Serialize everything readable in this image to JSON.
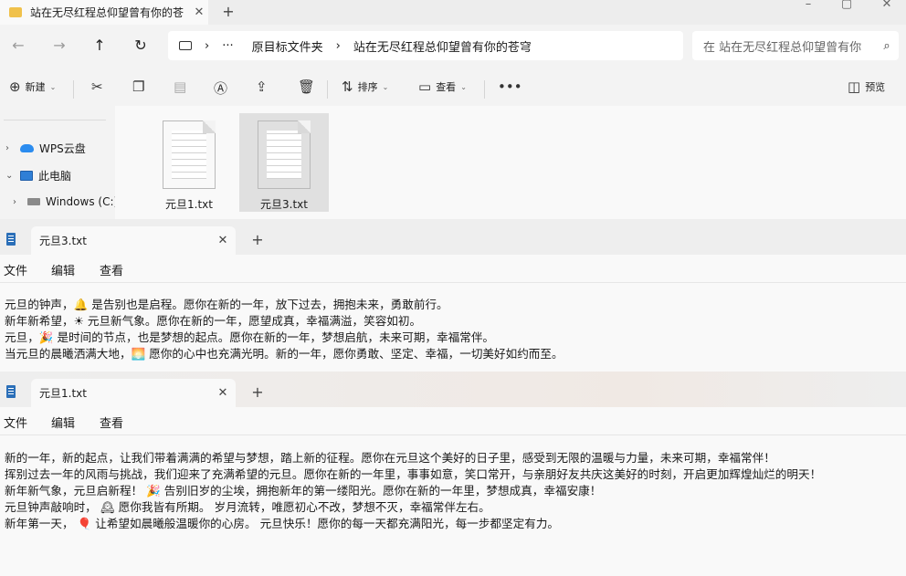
{
  "explorer": {
    "tab_title": "站在无尽红程总仰望曾有你的苍",
    "breadcrumb": [
      "原目标文件夹",
      "站在无尽红程总仰望曾有你的苍穹"
    ],
    "search_placeholder": "在 站在无尽红程总仰望曾有你",
    "toolbar": {
      "new_label": "新建",
      "sort_label": "排序",
      "view_label": "查看",
      "preview_label": "预览"
    },
    "nav_items": [
      {
        "label": "WPS云盘",
        "icon": "cloud-icon"
      },
      {
        "label": "此电脑",
        "icon": "computer-icon"
      },
      {
        "label": "Windows (C:)",
        "icon": "drive-icon"
      }
    ],
    "files": [
      {
        "name": "元旦1.txt",
        "selected": false
      },
      {
        "name": "元旦3.txt",
        "selected": true
      }
    ]
  },
  "notepad_top": {
    "tab_title": "元旦3.txt",
    "menu": [
      "文件",
      "编辑",
      "查看"
    ],
    "lines": [
      "元旦的钟声，🔔 是告别也是启程。愿你在新的一年，放下过去，拥抱未来，勇敢前行。",
      "新年新希望，☀ 元旦新气象。愿你在新的一年，愿望成真，幸福满溢，笑容如初。",
      "元旦，🎉 是时间的节点，也是梦想的起点。愿你在新的一年，梦想启航，未来可期，幸福常伴。",
      "当元旦的晨曦洒满大地，🌅 愿你的心中也充满光明。新的一年，愿你勇敢、坚定、幸福，一切美好如约而至。"
    ]
  },
  "notepad_bottom": {
    "tab_title": "元旦1.txt",
    "menu": [
      "文件",
      "编辑",
      "查看"
    ],
    "lines": [
      "新的一年，新的起点，让我们带着满满的希望与梦想，踏上新的征程。愿你在元旦这个美好的日子里，感受到无限的温暖与力量，未来可期，幸福常伴！",
      "挥别过去一年的风雨与挑战，我们迎来了充满希望的元旦。愿你在新的一年里，事事如意，笑口常开，与亲朋好友共庆这美好的时刻，开启更加辉煌灿烂的明天！",
      "新年新气象，元旦启新程！ 🎉 告别旧岁的尘埃，拥抱新年的第一缕阳光。愿你在新的一年里，梦想成真，幸福安康！",
      "元旦钟声敲响时， 🕰 愿你我皆有所期。 岁月流转，唯愿初心不改，梦想不灭，幸福常伴左右。",
      "新年第一天， 🎈 让希望如晨曦般温暖你的心房。 元旦快乐！愿你的每一天都充满阳光，每一步都坚定有力。"
    ]
  }
}
